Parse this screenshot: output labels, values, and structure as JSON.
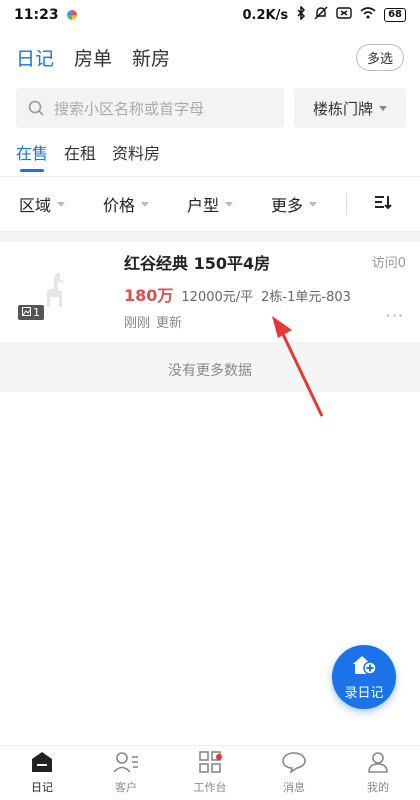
{
  "status": {
    "time": "11:23",
    "net_speed": "0.2K/s",
    "battery": "68"
  },
  "top_nav": {
    "tabs": [
      "日记",
      "房单",
      "新房"
    ],
    "multi_select": "多选"
  },
  "search": {
    "placeholder": "搜索小区名称或首字母",
    "building_button": "楼栋门牌"
  },
  "sub_tabs": [
    "在售",
    "在租",
    "资料房"
  ],
  "filters": [
    "区域",
    "价格",
    "户型",
    "更多"
  ],
  "listing": {
    "title": "红谷经典 150平4房",
    "price": "180万",
    "unit_price": "12000元/平",
    "unit_info": "2栋-1单元-803",
    "updated_a": "刚刚",
    "updated_b": "更新",
    "visits": "访问0",
    "photo_count": "1",
    "more": "···"
  },
  "no_more_text": "没有更多数据",
  "fab_label": "录日记",
  "bottom_nav": [
    "日记",
    "客户",
    "工作台",
    "消息",
    "我的"
  ],
  "colors": {
    "accent": "#1a73e8",
    "price": "#e04d4d",
    "annotation_arrow": "#e53935"
  }
}
